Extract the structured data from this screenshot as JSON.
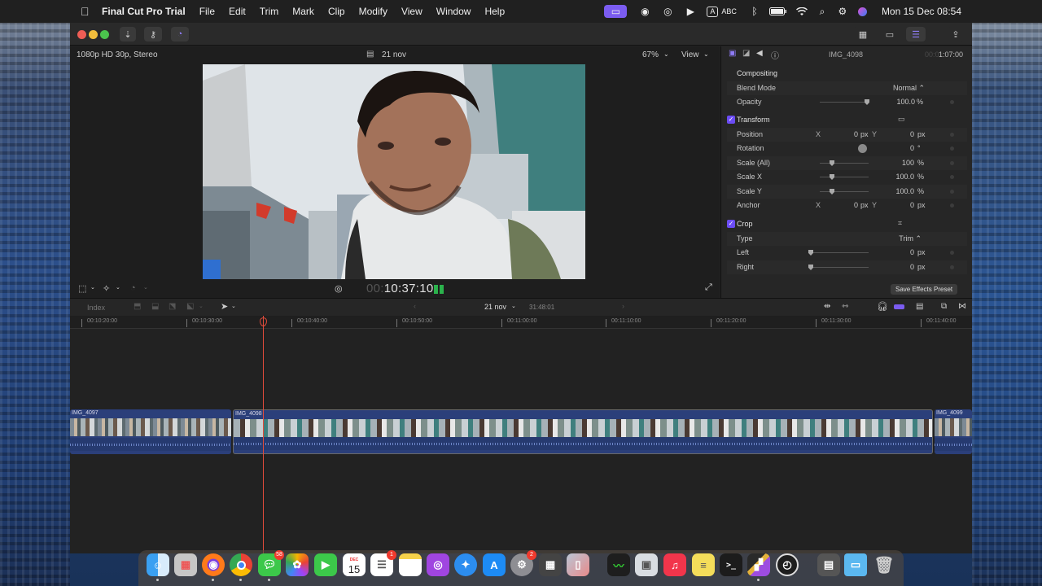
{
  "menubar": {
    "app_name": "Final Cut Pro Trial",
    "items": [
      "File",
      "Edit",
      "Trim",
      "Mark",
      "Clip",
      "Modify",
      "View",
      "Window",
      "Help"
    ],
    "input_label": "A",
    "input_source": "ABC",
    "clock": "Mon 15 Dec  08:54"
  },
  "viewer": {
    "format": "1080p HD 30p, Stereo",
    "date": "21 nov",
    "zoom": "67%",
    "view_label": "View",
    "timecode_dim": "00:",
    "timecode": "10:37:10"
  },
  "inspector": {
    "clip_name": "IMG_4098",
    "duration_dim": "00:0",
    "duration": "1:07:00",
    "compositing": {
      "title": "Compositing",
      "blend_mode_label": "Blend Mode",
      "blend_mode_value": "Normal ⌃",
      "opacity_label": "Opacity",
      "opacity_value": "100.0",
      "opacity_unit": "%"
    },
    "transform": {
      "title": "Transform",
      "position_label": "Position",
      "x_label": "X",
      "y_label": "Y",
      "position_x": "0",
      "position_y": "0",
      "px": "px",
      "rotation_label": "Rotation",
      "rotation_value": "0",
      "rotation_unit": "°",
      "scale_all_label": "Scale (All)",
      "scale_all_value": "100",
      "scale_x_label": "Scale X",
      "scale_x_value": "100.0",
      "scale_y_label": "Scale Y",
      "scale_y_value": "100.0",
      "percent": "%",
      "anchor_label": "Anchor",
      "anchor_x": "0",
      "anchor_y": "0"
    },
    "crop": {
      "title": "Crop",
      "type_label": "Type",
      "type_value": "Trim ⌃",
      "left_label": "Left",
      "left_value": "0",
      "right_label": "Right",
      "right_value": "0"
    },
    "save_preset": "Save Effects Preset"
  },
  "timeline_toolbar": {
    "index": "Index",
    "project": "21 nov",
    "duration": "31:48:01"
  },
  "ruler": {
    "ticks": [
      "00:10:20:00",
      "00:10:30:00",
      "00:10:40:00",
      "00:10:50:00",
      "00:11:00:00",
      "00:11:10:00",
      "00:11:20:00",
      "00:11:30:00",
      "00:11:40:00"
    ]
  },
  "clips": [
    "IMG_4097",
    "IMG_4098",
    "IMG_4099"
  ],
  "dock": {
    "messages_badge": "58",
    "calendar_month": "DEC",
    "calendar_day": "15",
    "reminders_badge": "1",
    "settings_badge": "2"
  }
}
